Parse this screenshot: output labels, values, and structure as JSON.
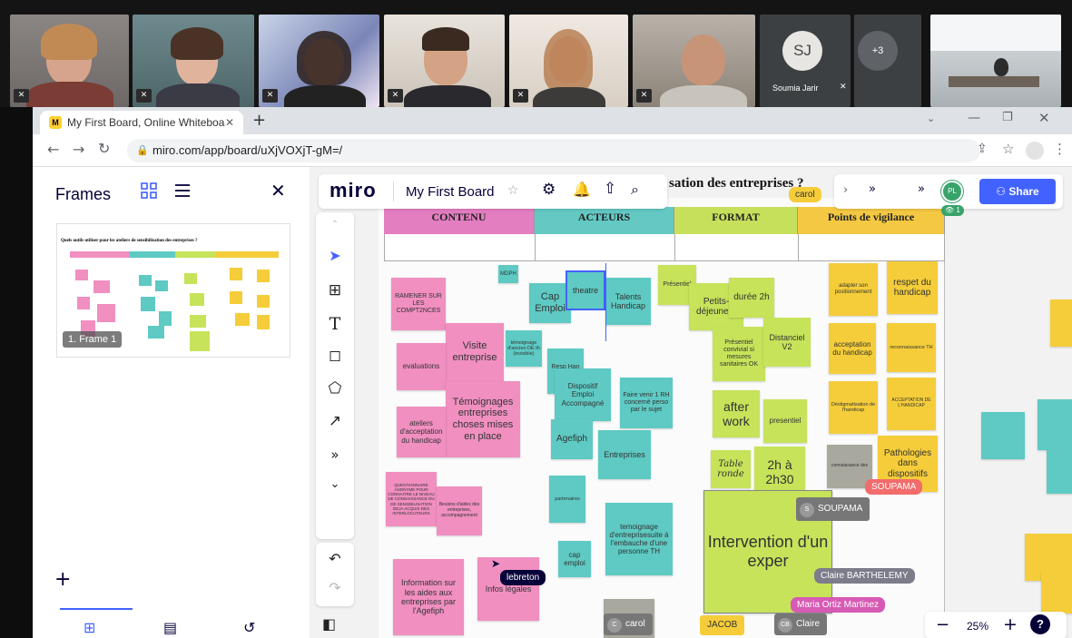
{
  "video": {
    "participant_name": "Soumia Jarir",
    "avatar_initials": "SJ",
    "more_count": "+3",
    "mic_muted_icon": "mic-off-icon"
  },
  "browser": {
    "tab_title": "My First Board, Online Whiteboa",
    "new_tab": "+",
    "url": "miro.com/app/board/uXjVOXjT-gM=/"
  },
  "sidebar": {
    "title": "Frames",
    "frame_label": "1. Frame 1",
    "thumb_title": "Quels outils utiliser pour les ateliers de sensibilisation des entreprises ?",
    "add": "+"
  },
  "board": {
    "logo": "miro",
    "name": "My First Board",
    "partial_title": "sation des entreprises ?",
    "share": "Share",
    "user_initials": "PL",
    "viewer_count": "1",
    "zoom": "25%",
    "help": "?",
    "columns": [
      "CONTENU",
      "ACTEURS",
      "FORMAT",
      "Points de vigilance"
    ],
    "notes": {
      "ramener": "RAMENER SUR LES COMPT2NCES",
      "visite": "Visite entreprise",
      "evaluations": "evaluations",
      "temoignages": "Témoignages entreprises choses mises en place",
      "ateliers": "ateliers d'acceptation du handicap",
      "questionnaire": "QUESTIONNAIRE ANONYME POUR CONNAITRE LE NIVEAU DE CONNAISSANCE DU DE SENSIBILISATION DEJA ACQUIS DES INTERLOCUTEURS",
      "besoins": "Besoins d'aides des entreprises, accompagnement",
      "information": "Information sur les aides aux entreprises par l'Agefiph",
      "info_legales": "Infos légales",
      "mdph": "MDPH",
      "cap_emploi": "Cap Emploi",
      "theatre": "theatre",
      "talents": "Talents Handicap",
      "temoignage_ancien": "témoignage d'ancien DE th (invisible)",
      "resp": "Resp Han entr",
      "dispositif": "Dispositif Emploi Accompagné",
      "faire_venir": "Faire venir 1 RH concerné perso par le sujet",
      "agefiph": "Agefiph",
      "entreprises": "Entreprises",
      "partenaires": "partenaires",
      "temoignage_embauche": "temoignage d'entreprisesuite à l'embauche d'une personne TH",
      "cap_emploi2": "cap emploi",
      "presentiel": "Présentiel",
      "petits_dej": "Petits-déjeuners",
      "duree": "durée 2h",
      "presentiel_convivial": "Présentiel convivial si mesures sanitaires OK",
      "distanciel": "Distanciel V2",
      "after_work": "after work",
      "presentiel2": "presentiel",
      "table_ronde": "Table ronde",
      "deux_h": "2h à 2h30",
      "intervention": "Intervention d'un exper",
      "adapter": "adapter son positionnement",
      "respet": "respet du handicap",
      "acceptation": "acceptation du handicap",
      "reconnaissance": "reconnaissance TH",
      "destigmatisation": "Déstigmatisation de l'handicap",
      "acceptation_de": "ACCEPTATION DE L'HANDICAP",
      "pathologies": "Pathologies dans dispositifs",
      "connaissance": "connaissance des"
    },
    "cursors": {
      "carol_top": "carol",
      "soupama": "SOUPAMA",
      "soupama_badge": "S",
      "soupama_name": "SOUPAMA",
      "claire": "Claire BARTHELEMY",
      "maria": "Maria Ortiz Martinez",
      "lebreton": "lebreton",
      "carol_badge": "C",
      "carol_name": "carol",
      "jacob": "JACOB",
      "cb_badge": "CB",
      "claire_name": "Claire"
    }
  },
  "colors": {
    "pink": "#f08fc0",
    "teal": "#5ecac3",
    "green": "#c6e35a",
    "yellow": "#f5cd3a",
    "share_blue": "#4262ff"
  }
}
